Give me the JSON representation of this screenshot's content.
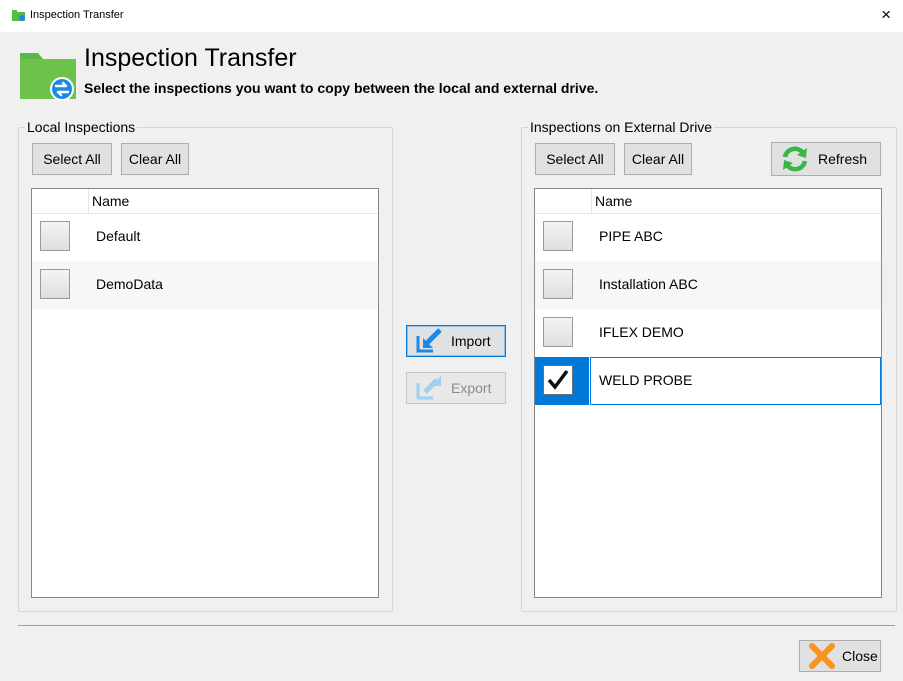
{
  "window": {
    "title": "Inspection Transfer",
    "close_glyph": "×"
  },
  "header": {
    "title": "Inspection Transfer",
    "subtitle": "Select the inspections you want to copy between the local and external drive."
  },
  "local": {
    "label": "Local Inspections",
    "select_all": "Select All",
    "clear_all": "Clear All",
    "column": "Name",
    "items": [
      {
        "name": "Default",
        "checked": false
      },
      {
        "name": "DemoData",
        "checked": false
      }
    ]
  },
  "external": {
    "label": "Inspections on External Drive",
    "select_all": "Select All",
    "clear_all": "Clear All",
    "refresh": "Refresh",
    "column": "Name",
    "items": [
      {
        "name": "PIPE ABC",
        "checked": false
      },
      {
        "name": "Installation ABC",
        "checked": false
      },
      {
        "name": "IFLEX DEMO",
        "checked": false
      },
      {
        "name": "WELD PROBE",
        "checked": true
      }
    ]
  },
  "transfer": {
    "import": "Import",
    "export": "Export"
  },
  "footer": {
    "close": "Close"
  },
  "colors": {
    "accent": "#0078d7",
    "folder_green": "#57b947",
    "refresh_green": "#39b54a",
    "close_orange": "#f7931e"
  }
}
